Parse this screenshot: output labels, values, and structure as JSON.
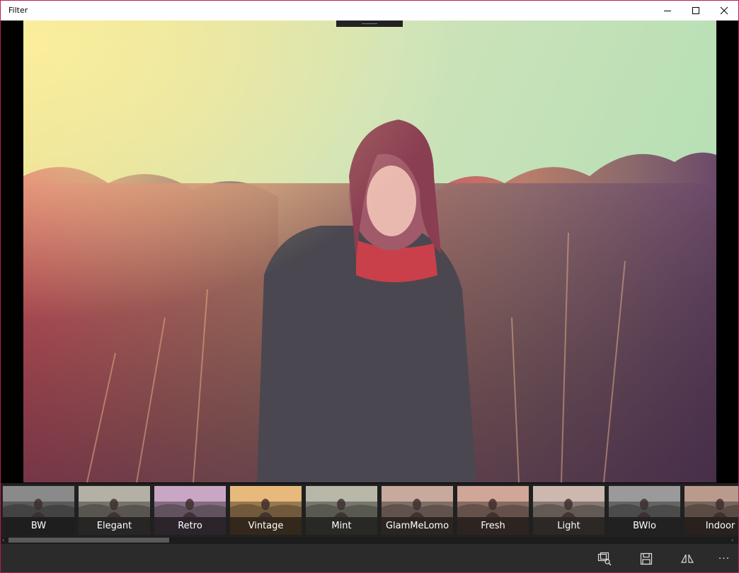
{
  "window": {
    "title": "Filter",
    "minimize_icon": "minimize-icon",
    "maximize_icon": "maximize-icon",
    "close_icon": "close-icon"
  },
  "filters": [
    {
      "label": "BW",
      "tint": "#8a8a8a"
    },
    {
      "label": "Elegant",
      "tint": "#b5b0a6"
    },
    {
      "label": "Retro",
      "tint": "#c9a7c4",
      "selected": true
    },
    {
      "label": "Vintage",
      "tint": "#e8b97c"
    },
    {
      "label": "Mint",
      "tint": "#b9b7a8"
    },
    {
      "label": "GlamMeLomo",
      "tint": "#c7a99d"
    },
    {
      "label": "Fresh",
      "tint": "#d0a698"
    },
    {
      "label": "Light",
      "tint": "#cdb8b0"
    },
    {
      "label": "BWlo",
      "tint": "#9a9a9a"
    },
    {
      "label": "Indoor",
      "tint": "#b99a8c"
    }
  ],
  "scrollbar": {
    "left_arrow": "‹",
    "right_arrow": "›"
  },
  "commands": {
    "compare_search_icon": "compare-search-icon",
    "save_icon": "save-icon",
    "compare_icon": "compare-icon",
    "more": "···"
  },
  "colors": {
    "accent": "#8b0d14",
    "window_border": "#c2185b"
  }
}
